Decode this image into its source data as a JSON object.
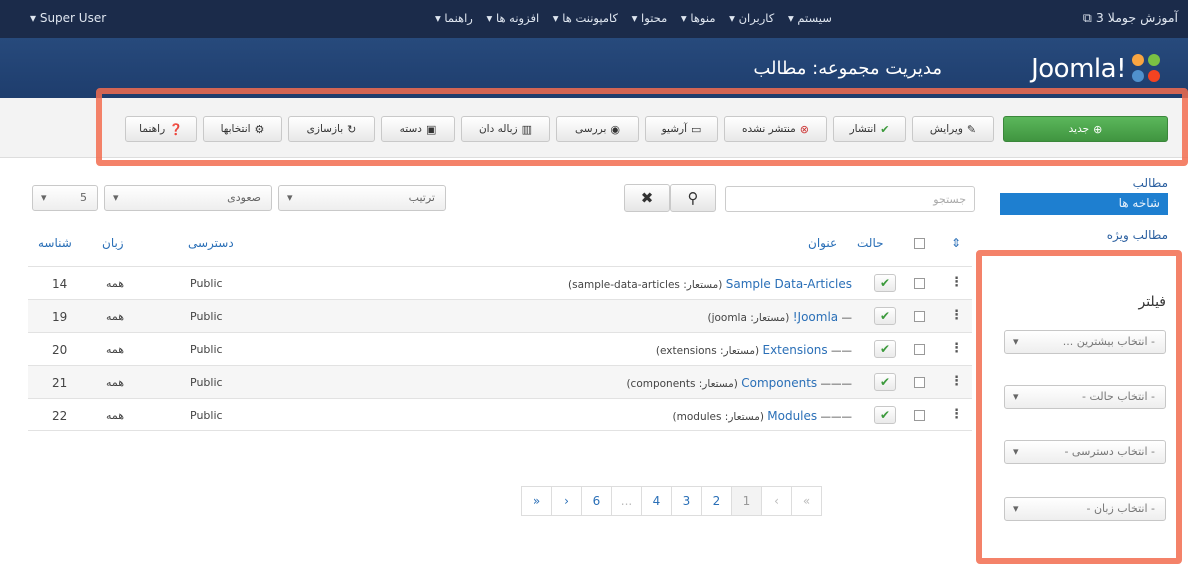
{
  "topbar": {
    "user": "▾ Super User",
    "menu": [
      "سیستم ▾",
      "کاربران ▾",
      "منوها ▾",
      "محتوا ▾",
      "کامپوننت ها ▾",
      "افزونه ها ▾",
      "راهنما ▾"
    ],
    "site": "آموزش جوملا 3"
  },
  "header": {
    "title": "مدیریت مجموعه: مطالب",
    "logo_text": "Joomla!"
  },
  "toolbar": {
    "new": "جدید",
    "edit": "ویرایش",
    "publish": "انتشار",
    "unpublish": "منتشر نشده",
    "archive": "آرشیو",
    "checkin": "بررسی",
    "trash": "زباله دان",
    "batch": "دسته",
    "rebuild": "بازسازی",
    "options": "انتخابها",
    "help": "راهنما"
  },
  "sidebar": {
    "articles": "مطالب",
    "categories": "شاخه ها",
    "featured": "مطالب ویژه"
  },
  "filters": {
    "title": "فیلتر",
    "max_levels": "- انتخاب بیشترین ...",
    "status": "- انتخاب حالت -",
    "access": "- انتخاب دسترسی -",
    "language": "- انتخاب زبان -"
  },
  "search": {
    "placeholder": "جستجو"
  },
  "list_controls": {
    "ordering": "ترتیب",
    "direction": "صعودی",
    "limit": "5"
  },
  "columns": {
    "status": "حالت",
    "title": "عنوان",
    "access": "دسترسی",
    "language": "زبان",
    "id": "شناسه"
  },
  "rows": [
    {
      "prefix": "",
      "title": "Sample Data-Articles",
      "alias": "(مستعار: sample-data-articles)",
      "access": "Public",
      "language": "همه",
      "id": "14"
    },
    {
      "prefix": "— ",
      "title": "Joomla!",
      "alias": "(مستعار: joomla)",
      "access": "Public",
      "language": "همه",
      "id": "19"
    },
    {
      "prefix": "—— ",
      "title": "Extensions",
      "alias": "(مستعار: extensions)",
      "access": "Public",
      "language": "همه",
      "id": "20"
    },
    {
      "prefix": "——— ",
      "title": "Components",
      "alias": "(مستعار: components)",
      "access": "Public",
      "language": "همه",
      "id": "21"
    },
    {
      "prefix": "——— ",
      "title": "Modules",
      "alias": "(مستعار: modules)",
      "access": "Public",
      "language": "همه",
      "id": "22"
    }
  ],
  "pagination": [
    "«",
    "‹",
    "1",
    "2",
    "3",
    "4",
    "...",
    "6",
    "›",
    "»"
  ],
  "colors": {
    "topbar": "#1b2b4a",
    "header": "#1e3d6d",
    "accent": "#1e7fd0",
    "new_button": "#4aa64a",
    "highlight": "#f26c4f"
  }
}
